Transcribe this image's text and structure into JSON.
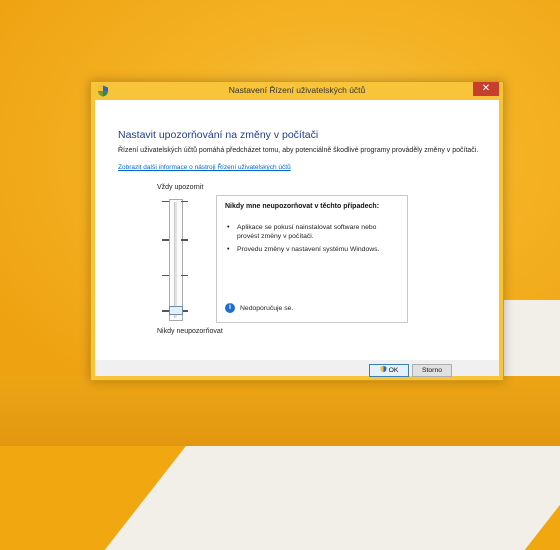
{
  "window": {
    "title": "Nastavení Řízení uživatelských účtů",
    "close_glyph": "✕"
  },
  "content": {
    "heading": "Nastavit upozorňování na změny v počítači",
    "description": "Řízení uživatelských účtů pomáhá předcházet tomu, aby potenciálně škodlivé programy prováděly změny v počítači.",
    "link": "Zobrazit další informace o nástroji Řízení uživatelských účtů"
  },
  "slider": {
    "top_label": "Vždy upozornit",
    "bottom_label": "Nikdy neupozorňovat",
    "level": 1,
    "levels": 4
  },
  "info": {
    "title": "Nikdy mne neupozorňovat v těchto případech:",
    "bullets": [
      "Aplikace se pokusí nainstalovat software nebo provést změny v počítači.",
      "Provedu změny v nastavení systému Windows."
    ],
    "recommendation": "Nedoporučuje se."
  },
  "buttons": {
    "ok": "OK",
    "cancel": "Storno"
  },
  "colors": {
    "accent": "#1e3d8f",
    "titlebar": "#f7c43a",
    "close": "#c7402f",
    "desktop": "#f1a70f"
  },
  "icons": {
    "title": "uac-shield-icon",
    "info": "info-icon",
    "ok_shield": "uac-shield-icon"
  }
}
